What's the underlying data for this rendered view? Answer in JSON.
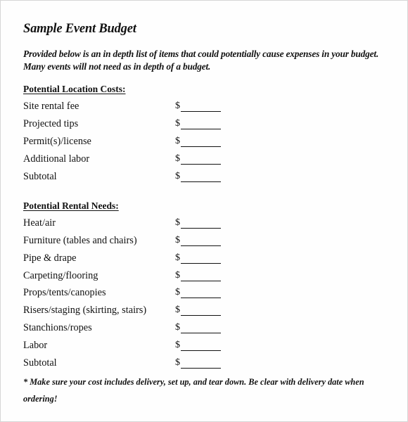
{
  "document": {
    "title": "Sample Event Budget",
    "intro": "Provided below is an in depth list of items that could potentially cause expenses in your budget. Many events will not need as in depth of a budget.",
    "currency_symbol": "$",
    "sections": [
      {
        "heading": "Potential Location Costs:",
        "items": [
          {
            "label": "Site rental fee",
            "amount": ""
          },
          {
            "label": "Projected tips",
            "amount": ""
          },
          {
            "label": "Permit(s)/license",
            "amount": ""
          },
          {
            "label": "Additional labor",
            "amount": ""
          },
          {
            "label": "Subtotal",
            "amount": ""
          }
        ]
      },
      {
        "heading": "Potential Rental Needs:",
        "items": [
          {
            "label": "Heat/air",
            "amount": ""
          },
          {
            "label": "Furniture (tables and chairs)",
            "amount": ""
          },
          {
            "label": "Pipe & drape",
            "amount": ""
          },
          {
            "label": "Carpeting/flooring",
            "amount": ""
          },
          {
            "label": "Props/tents/canopies",
            "amount": ""
          },
          {
            "label": "Risers/staging (skirting, stairs)",
            "amount": ""
          },
          {
            "label": "Stanchions/ropes",
            "amount": ""
          },
          {
            "label": "Labor",
            "amount": ""
          },
          {
            "label": "Subtotal",
            "amount": ""
          }
        ]
      }
    ],
    "note": "* Make sure your cost includes delivery, set up, and tear down. Be clear with delivery date when ordering!"
  }
}
